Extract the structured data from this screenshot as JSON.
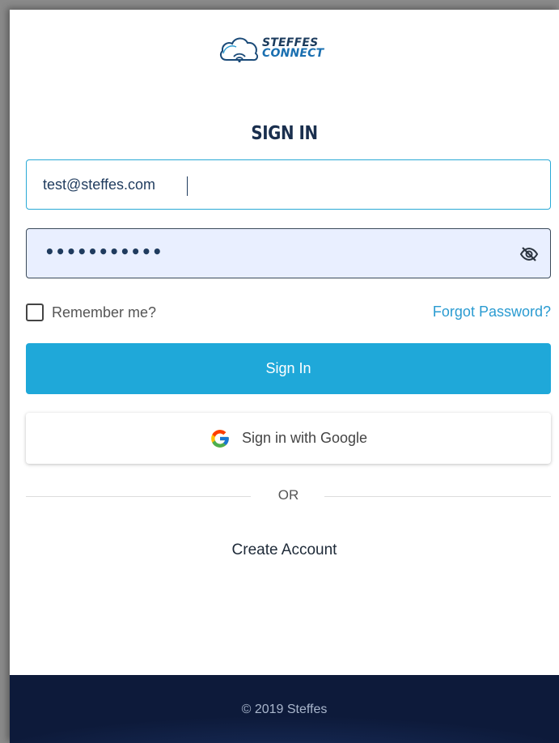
{
  "logo": {
    "line1": "STEFFES",
    "line2": "CONNECT",
    "icon": "cloud-wifi-icon"
  },
  "title": "SIGN IN",
  "email": {
    "value": "test@steffes.com",
    "placeholder": ""
  },
  "password": {
    "masked_value": "•••••••••••",
    "toggle_icon": "eye-off-icon"
  },
  "remember": {
    "label": "Remember me?",
    "checked": false
  },
  "forgot_password": "Forgot Password?",
  "signin_button": "Sign In",
  "google_button": {
    "label": "Sign in with Google",
    "icon": "google-g-icon"
  },
  "divider_text": "OR",
  "create_account": "Create Account",
  "footer": {
    "copyright": "© 2019 Steffes"
  },
  "colors": {
    "accent": "#1fa8d9",
    "link": "#2a9bd1",
    "title": "#1a2f4e",
    "footer_bg": "#13244b",
    "password_bg": "#e9efff"
  }
}
